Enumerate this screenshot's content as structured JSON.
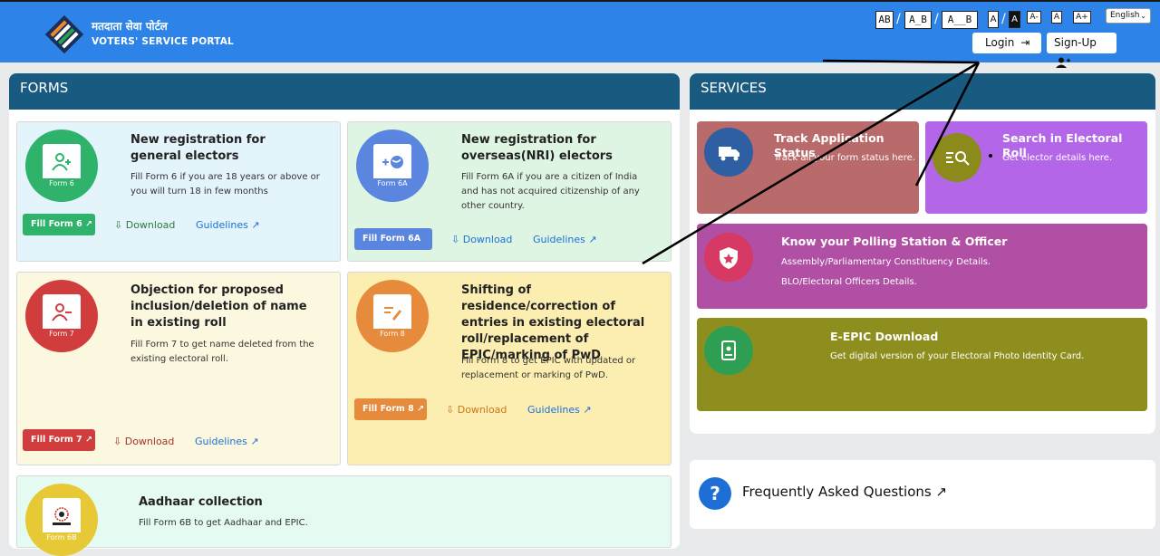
{
  "header": {
    "brand_hindi": "मतदाता सेवा पोर्टल",
    "brand_english": "VOTERS' SERVICE PORTAL",
    "accessibility": {
      "contrast_options": [
        "AB",
        "A_B",
        "A__B"
      ],
      "font_options": [
        "A",
        "A",
        "A-",
        "A",
        "A+"
      ]
    },
    "language": "English",
    "login_label": "Login",
    "signup_label": "Sign-Up"
  },
  "forms": {
    "heading": "FORMS",
    "cards": [
      {
        "title": "New registration for general electors",
        "desc": "Fill Form 6 if you are 18 years or above or you will turn 18 in few months",
        "form_label": "Form 6",
        "fill_label": "Fill Form 6",
        "download_label": "Download",
        "guidelines_label": "Guidelines",
        "color": "#2fb36b",
        "bg": "#e3f4fb"
      },
      {
        "title": "New registration for overseas(NRI) electors",
        "desc": "Fill Form 6A if you are a citizen of India and has not acquired citizenship of any other country.",
        "form_label": "Form 6A",
        "fill_label": "Fill Form 6A",
        "download_label": "Download",
        "guidelines_label": "Guidelines",
        "color": "#5b86e0",
        "bg": "#dff5e3"
      },
      {
        "title": "Objection for proposed inclusion/deletion of name in existing roll",
        "desc": "Fill Form 7 to get name deleted from the existing electoral roll.",
        "form_label": "Form 7",
        "fill_label": "Fill Form 7",
        "download_label": "Download",
        "guidelines_label": "Guidelines",
        "color": "#d13c3c",
        "bg": "#fcf8df"
      },
      {
        "title": "Shifting of residence/correction of entries in existing electoral roll/replacement of EPIC/marking of PwD",
        "desc": "Fill Form 8 to get EPIC with updated or replacement or marking of PwD.",
        "form_label": "Form 8",
        "fill_label": "Fill Form 8",
        "download_label": "Download",
        "guidelines_label": "Guidelines",
        "color": "#e68a3c",
        "bg": "#fbeeb0"
      },
      {
        "title": "Aadhaar collection",
        "desc": "Fill Form 6B to get Aadhaar and EPIC.",
        "form_label": "Form 6B",
        "color": "#e6c935",
        "bg": "#e5faf0"
      }
    ]
  },
  "services": {
    "heading": "SERVICES",
    "items": [
      {
        "title": "Track Application Status",
        "desc": "Track all your form status here.",
        "color": "#b96a6a",
        "icon_color": "#2e5fa3"
      },
      {
        "title": "Search in Electoral Roll",
        "desc": "Get elector details here.",
        "color": "#b367e8",
        "icon_color": "#8c8a1a"
      },
      {
        "title": "Know your Polling Station & Officer",
        "desc": "Assembly/Parliamentary Constituency Details.",
        "desc2": "BLO/Electoral Officers Details.",
        "color": "#b04fa3",
        "icon_color": "#d63a64"
      },
      {
        "title": "E-EPIC Download",
        "desc": "Get digital version of your Electoral Photo Identity Card.",
        "color": "#8e8e1e",
        "icon_color": "#2e9e52"
      }
    ]
  },
  "faq": {
    "label": "Frequently Asked Questions",
    "icon_text": "?"
  }
}
